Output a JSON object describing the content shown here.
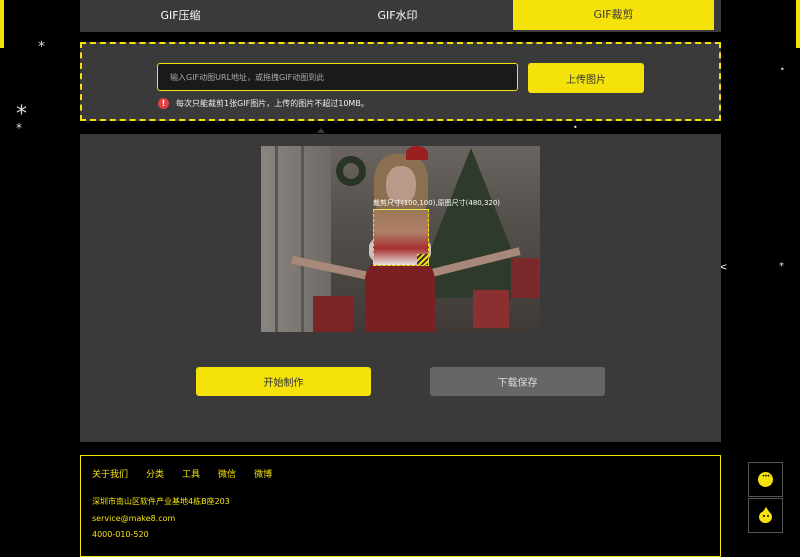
{
  "tabs": [
    {
      "label": "GIF压缩",
      "active": false
    },
    {
      "label": "GIF水印",
      "active": false
    },
    {
      "label": "GIF裁剪",
      "active": true
    }
  ],
  "upload": {
    "placeholder": "输入GIF动图URL地址，或拖拽GIF动图到此",
    "button_label": "上传图片",
    "notice_icon": "!",
    "notice": "每次只能裁剪1张GIF图片，上传的图片不超过10MB。"
  },
  "editor": {
    "crop_label": "裁剪尺寸(100,100),原图尺寸(480,320)",
    "start_label": "开始制作",
    "download_label": "下载保存"
  },
  "footer": {
    "links": [
      "关于我们",
      "分类",
      "工具",
      "微信",
      "微博"
    ],
    "address": "深圳市南山区软件产业基地4栋B座203",
    "email": "service@make8.com",
    "phone": "4000-010-520"
  },
  "colors": {
    "accent": "#f5e20a",
    "panel": "#3a3a3a",
    "background": "#000000",
    "notice_icon": "#e24040",
    "disabled_button": "#666666"
  },
  "icons": {
    "notice": "exclamation-circle-icon",
    "resize": "resize-handle-icon",
    "chat": "chat-bubble-icon",
    "back_to_top": "back-to-top-icon",
    "snowflake": "snowflake-icon"
  }
}
